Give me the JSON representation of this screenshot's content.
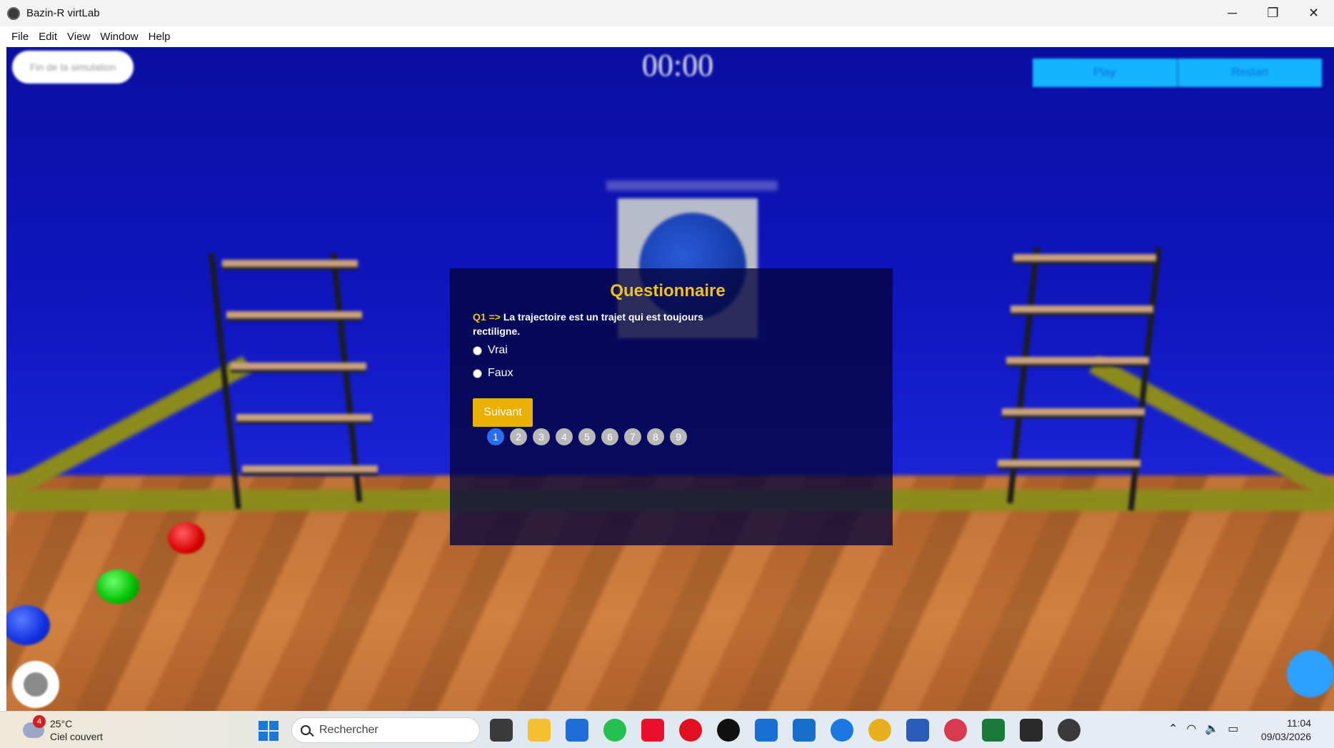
{
  "window": {
    "title": "Bazin-R virtLab",
    "controls": {
      "minimize": "─",
      "restore": "❐",
      "close": "✕"
    }
  },
  "menu": {
    "items": [
      "File",
      "Edit",
      "View",
      "Window",
      "Help"
    ]
  },
  "scene": {
    "timer": "00:00",
    "end_simulation_label": "Fin de la simulation",
    "play_label": "Play",
    "reset_label": "Restart"
  },
  "quiz": {
    "title": "Questionnaire",
    "question_prefix": "Q1 =>",
    "question_text": "La trajectoire est un trajet qui est toujours rectiligne.",
    "options": [
      "Vrai",
      "Faux"
    ],
    "next_label": "Suivant",
    "pages": [
      "1",
      "2",
      "3",
      "4",
      "5",
      "6",
      "7",
      "8",
      "9"
    ],
    "active_page": "1"
  },
  "taskbar": {
    "weather": {
      "badge": "4",
      "temperature": "25°C",
      "condition": "Ciel couvert"
    },
    "search_placeholder": "Rechercher",
    "time": "11:04",
    "date": "09/03/2026"
  }
}
